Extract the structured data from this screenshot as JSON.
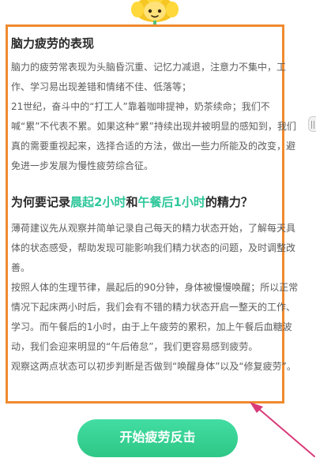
{
  "colors": {
    "accent": "#2fc79b",
    "card_border": "#f08a2f",
    "button_bg": "#2ec786",
    "annotation_arrow": "#d93a78"
  },
  "mascot": {
    "icon": "sunflower-mascot-icon"
  },
  "card": {
    "section1": {
      "title": "脑力疲劳的表现",
      "body": "脑力的疲劳常表现为头脑昏沉重、记忆力减退，注意力不集中，工作、学习易出现差错和情绪不佳、低落等；\n21世纪，奋斗中的“打工人”靠着咖啡提神，奶茶续命；我们不喊“累”不代表不累。如果这种“累”持续出现并被明显的感知到，我们真的需要重视起来，选择合适的方法，做出一些力所能及的改变，避免进一步发展为慢性疲劳综合征。"
    },
    "section2": {
      "title_part1": "为何要记录",
      "title_highlight1": "晨起2小时",
      "title_and": "和",
      "title_highlight2": "午餐后1小时",
      "title_part2": "的精力？",
      "body": "薄荷建议先从观察并简单记录自己每天的精力状态开始，了解每天具体的状态感受，帮助发现可能影响我们精力状态的问题，及时调整改善。\n按照人体的生理节律，晨起后的90分钟，身体被慢慢唤醒；所以正常情况下起床两小时后，我们会有不错的精力状态开启一整天的工作、学习。而午餐后的1小时，由于上午疲劳的累积，加上午餐后血糖波动，我们会迎来明显的“午后倦怠”，我们更容易感到疲劳。\n观察这两点状态可以初步判断是否做到“唤醒身体”以及“修复疲劳”。"
    }
  },
  "side_handle": {
    "icon": "side-drawer-handle-icon"
  },
  "start_button": {
    "label": "开始疲劳反击"
  },
  "annotation": {
    "icon": "pointer-arrow-icon"
  }
}
